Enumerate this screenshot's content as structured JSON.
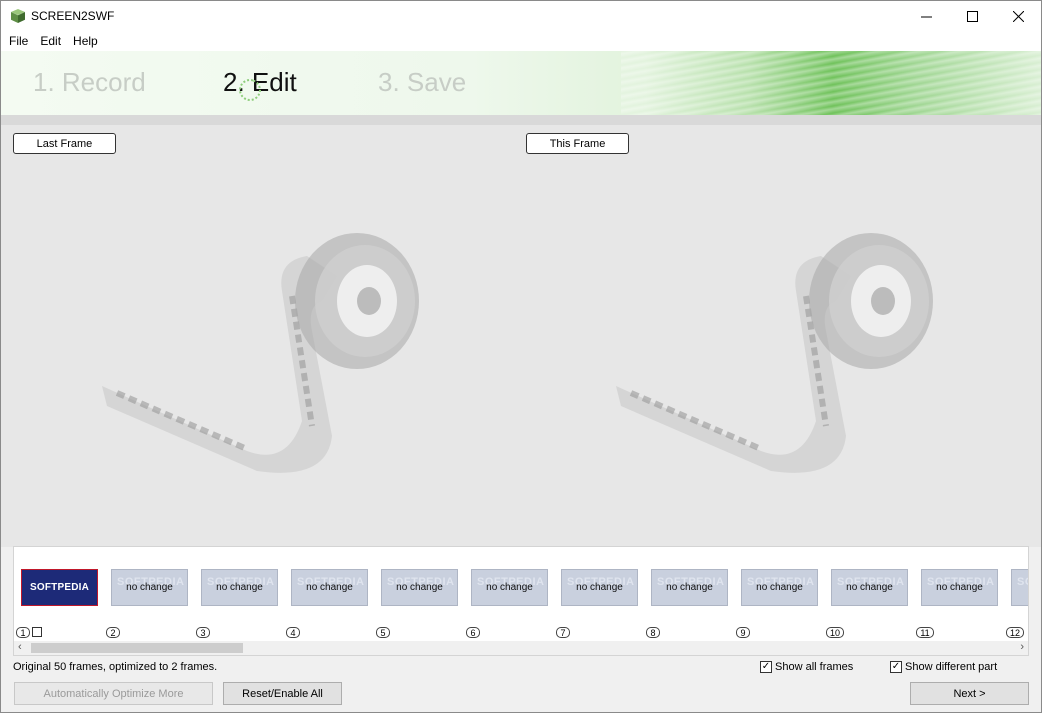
{
  "window": {
    "title": "SCREEN2SWF"
  },
  "menu": [
    "File",
    "Edit",
    "Help"
  ],
  "steps": {
    "record": "1. Record",
    "edit": "2. Edit",
    "save": "3. Save"
  },
  "preview": {
    "last_frame_label": "Last Frame",
    "this_frame_label": "This Frame"
  },
  "thumbnails": {
    "first_logo": "SOFTPEDIA",
    "watermark": "SOFTPEDIA",
    "no_change_text": "no change",
    "numbers": [
      "1",
      "2",
      "3",
      "4",
      "5",
      "6",
      "7",
      "8",
      "9",
      "10",
      "11",
      "12"
    ]
  },
  "status": {
    "summary": "Original 50 frames, optimized to 2 frames."
  },
  "options": {
    "show_all_frames": {
      "label": "Show all frames",
      "checked": true
    },
    "show_different_part": {
      "label": "Show different part",
      "checked": true
    }
  },
  "buttons": {
    "optimize": "Automatically Optimize More",
    "reset": "Reset/Enable All",
    "next": "Next >"
  },
  "icons": {
    "minimize": "minimize-icon",
    "maximize": "maximize-icon",
    "close": "close-icon"
  }
}
